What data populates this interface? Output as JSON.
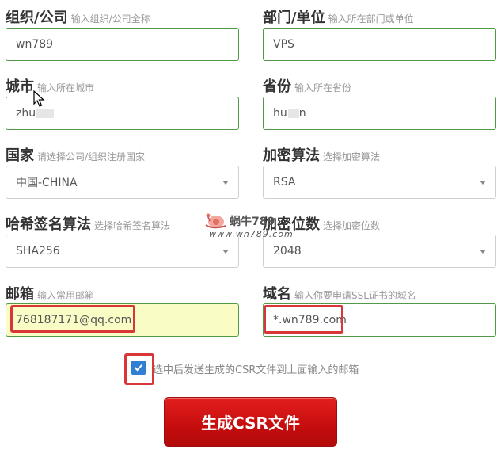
{
  "form": {
    "org": {
      "label": "组织/公司",
      "hint": "输入组织/公司全称",
      "value": "wn789"
    },
    "dept": {
      "label": "部门/单位",
      "hint": "输入所在部门或单位",
      "value": "VPS"
    },
    "city": {
      "label": "城市",
      "hint": "输入所在城市",
      "value": "zhu"
    },
    "province": {
      "label": "省份",
      "hint": "输入所在省份",
      "value": "hu",
      "value_tail": "n"
    },
    "country": {
      "label": "国家",
      "hint": "请选择公司/组织注册国家",
      "value": "中国-CHINA"
    },
    "algo": {
      "label": "加密算法",
      "hint": "选择加密算法",
      "value": "RSA"
    },
    "hash": {
      "label": "哈希签名算法",
      "hint": "选择哈希签名算法",
      "value": "SHA256"
    },
    "bits": {
      "label": "加密位数",
      "hint": "选择加密位数",
      "value": "2048"
    },
    "email": {
      "label": "邮箱",
      "hint": "输入常用邮箱",
      "value": "768187171@qq.com"
    },
    "domain": {
      "label": "域名",
      "hint": "输入你要申请SSL证书的域名",
      "value": "*.wn789.com"
    },
    "send_email": {
      "label": "选中后发送生成的CSR文件到上面输入的邮箱",
      "checked": true
    },
    "submit_label": "生成CSR文件"
  },
  "watermark": {
    "line1": "蜗牛789",
    "line2": "www.wn789.com"
  },
  "colors": {
    "input_border": "#4e9a45",
    "highlight": "#d9363a",
    "submit": "#d01414",
    "checkbox": "#2f7fd3"
  }
}
